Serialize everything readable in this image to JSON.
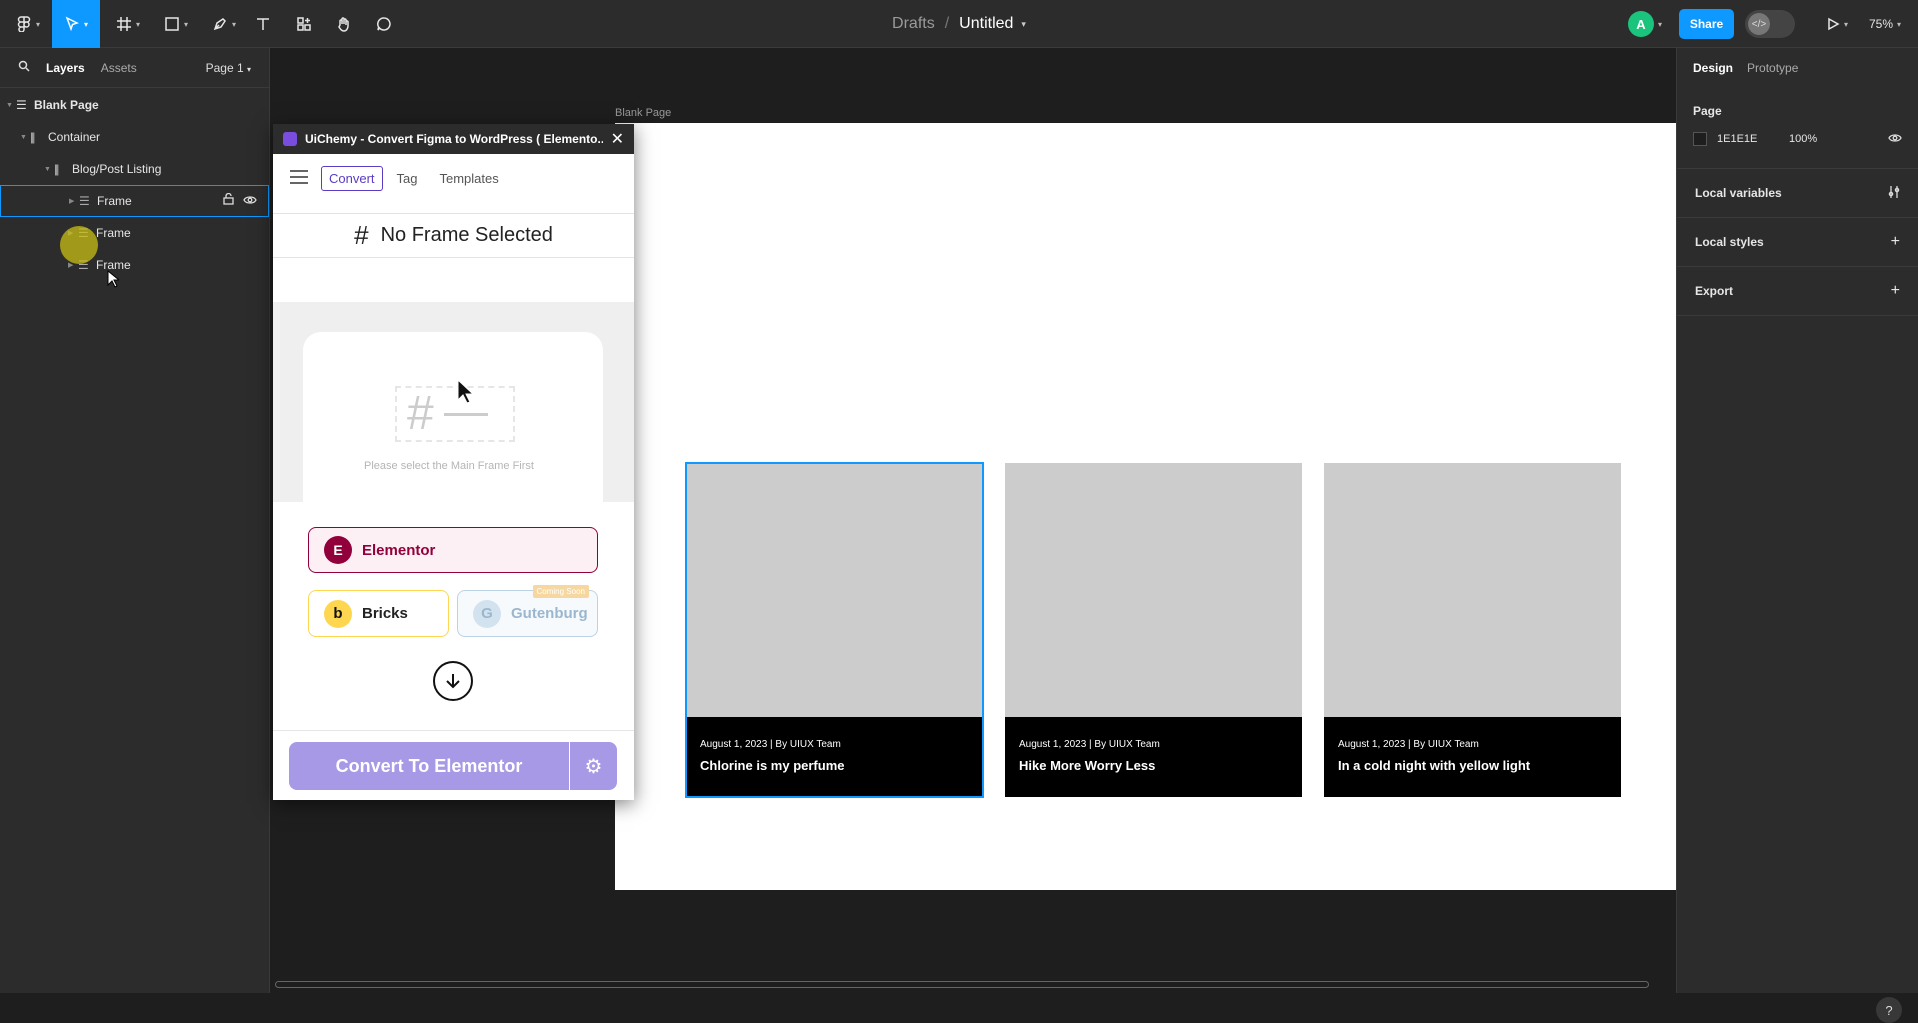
{
  "topbar": {
    "breadcrumb_parent": "Drafts",
    "breadcrumb_sep": "/",
    "file_name": "Untitled",
    "avatar_letter": "A",
    "share_label": "Share",
    "zoom": "75%"
  },
  "left_panel": {
    "tabs": [
      "Layers",
      "Assets"
    ],
    "page_select": "Page 1",
    "layers": [
      {
        "name": "Blank Page"
      },
      {
        "name": "Container"
      },
      {
        "name": "Blog/Post Listing"
      },
      {
        "name": "Frame"
      },
      {
        "name": "Frame"
      },
      {
        "name": "Frame"
      }
    ]
  },
  "right_panel": {
    "tabs": [
      "Design",
      "Prototype"
    ],
    "page_section": "Page",
    "page_color_hex": "1E1E1E",
    "page_opacity": "100%",
    "local_variables": "Local variables",
    "local_styles": "Local styles",
    "export": "Export"
  },
  "canvas": {
    "frame_label": "Blank Page",
    "cards": [
      {
        "meta": "August 1, 2023 | By UIUX Team",
        "title": "Chlorine is my perfume"
      },
      {
        "meta": "August 1, 2023 | By UIUX Team",
        "title": "Hike More Worry Less"
      },
      {
        "meta": "August 1, 2023 | By UIUX Team",
        "title": "In a cold night with yellow light"
      }
    ]
  },
  "plugin": {
    "title": "UiChemy - Convert Figma to WordPress ( Elemento...",
    "tabs": [
      "Convert",
      "Tag",
      "Templates"
    ],
    "no_frame": "No Frame Selected",
    "hint": "Please select the Main Frame First",
    "builders": {
      "elementor": "Elementor",
      "bricks": "Bricks",
      "gutenburg": "Gutenburg",
      "coming_soon": "Coming Soon"
    },
    "convert_button": "Convert To Elementor"
  },
  "colors": {
    "accent": "#0d99ff",
    "elementor": "#92003b",
    "bricks": "#ffd64f",
    "plugin_purple": "#a799e5",
    "card_image": "#cccccc"
  }
}
